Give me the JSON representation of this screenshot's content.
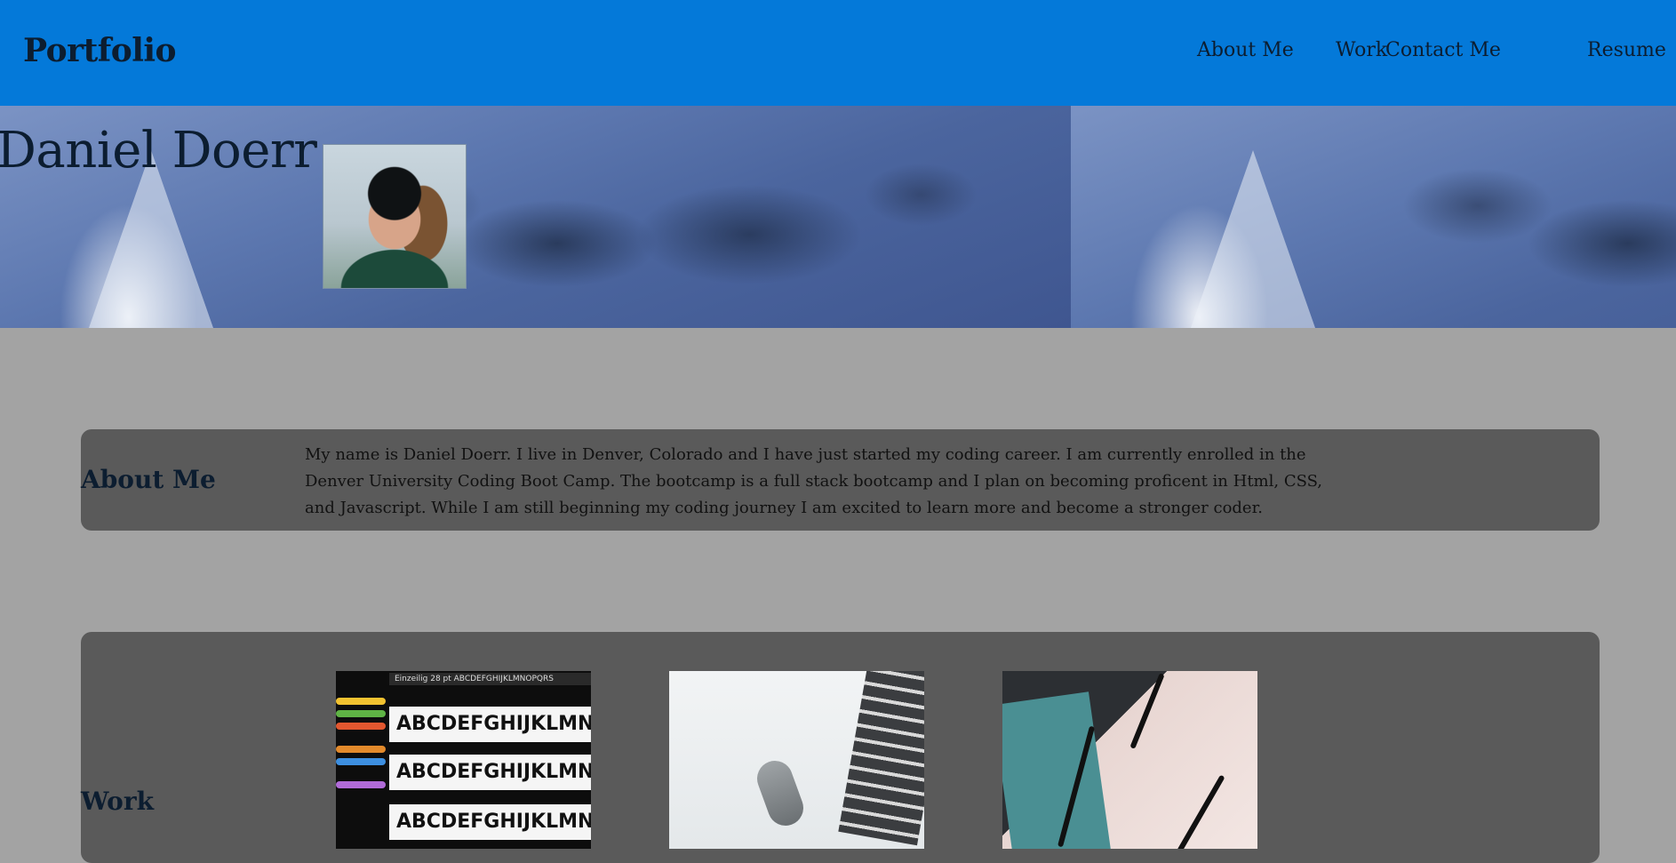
{
  "header": {
    "brand": "Portfolio",
    "nav": [
      {
        "label": "About Me"
      },
      {
        "label": "Work"
      },
      {
        "label": "Contact Me"
      },
      {
        "label": "Resume"
      }
    ]
  },
  "hero": {
    "name": "Daniel Doerr"
  },
  "about": {
    "title": "About Me",
    "text": "My name is Daniel Doerr. I live in Denver, Colorado and I have just started my coding career. I am currently enrolled in the Denver University Coding Boot Camp. The bootcamp is a full stack bootcamp and I plan on becoming proficent in Html, CSS, and Javascript. While I am still beginning my coding journey I am excited to learn more and become a stronger coder."
  },
  "work": {
    "title": "Work",
    "thumb1": {
      "toolbar": "Einzeilig  28 pt  ABCDEFGHIJKLMNOPQRS",
      "rows": [
        "ABCDEFGHIJKLMNO",
        "ABCDEFGHIJKLMNO",
        "ABCDEFGHIJKLMNO"
      ]
    }
  },
  "colors": {
    "header_bg": "#0479d9",
    "page_bg": "#a3a3a3",
    "panel_bg": "#5a5a5a",
    "text_dark": "#0c1d30"
  }
}
